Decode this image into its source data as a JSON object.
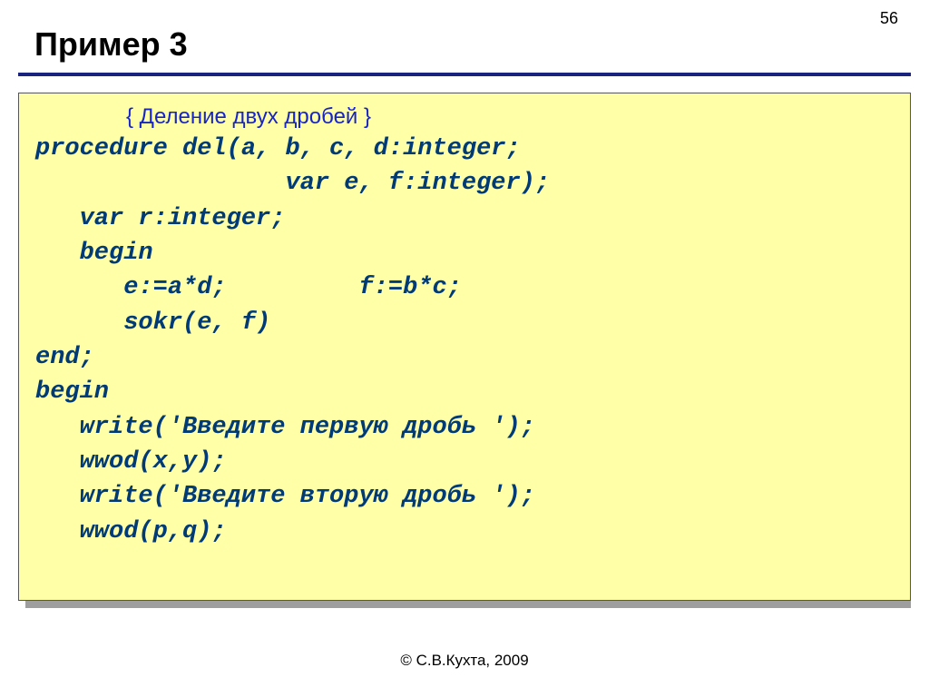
{
  "page_number": "56",
  "title": "Пример 3",
  "comment": "{ Деление двух дробей }",
  "code_lines": [
    "procedure del(a, b, c, d:integer;",
    "                 var e, f:integer);",
    "   var r:integer;",
    "   begin",
    "      e:=a*d;         f:=b*c;",
    "      sokr(e, f)",
    "end;",
    "",
    "begin",
    "   write('Введите первую дробь ');",
    "   wwod(x,y);",
    "   write('Введите вторую дробь ');",
    "   wwod(p,q);"
  ],
  "footer": "© С.В.Кухта, 2009"
}
